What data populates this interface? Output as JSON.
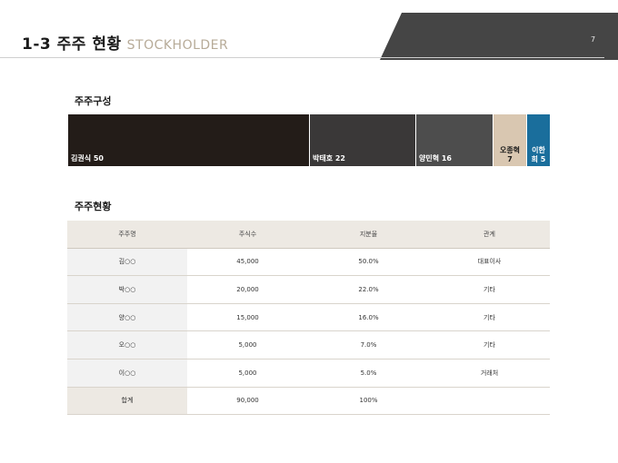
{
  "header": {
    "title": "1-3 주주 현황",
    "subtitle": "STOCKHOLDER",
    "page_number": "7",
    "band_color": "#454545"
  },
  "composition": {
    "heading": "주주구성",
    "segments": [
      {
        "name": "김권식",
        "value": 50,
        "label": "김권식 50",
        "color": "#231c18"
      },
      {
        "name": "박태호",
        "value": 22,
        "label": "박태호 22",
        "color": "#3a3838"
      },
      {
        "name": "양민혁",
        "value": 16,
        "label": "양민혁 16",
        "color": "#4d4d4d"
      },
      {
        "name": "오종혁",
        "value": 7,
        "label_top": "오종혁",
        "label_bottom": "7",
        "color": "#d9c7b1"
      },
      {
        "name": "이한희",
        "value": 5,
        "label_top": "이한",
        "label_bottom": "희 5",
        "color": "#1a6e9c"
      }
    ]
  },
  "holders": {
    "heading": "주주현황",
    "columns": [
      "주주명",
      "주식수",
      "지분율",
      "관계"
    ],
    "rows": [
      [
        "김○○",
        "45,000",
        "50.0%",
        "대표이사"
      ],
      [
        "박○○",
        "20,000",
        "22.0%",
        "기타"
      ],
      [
        "양○○",
        "15,000",
        "16.0%",
        "기타"
      ],
      [
        "오○○",
        "5,000",
        "7.0%",
        "기타"
      ],
      [
        "이○○",
        "5,000",
        "5.0%",
        "거래처"
      ]
    ],
    "total": [
      "합계",
      "90,000",
      "100%",
      ""
    ]
  }
}
